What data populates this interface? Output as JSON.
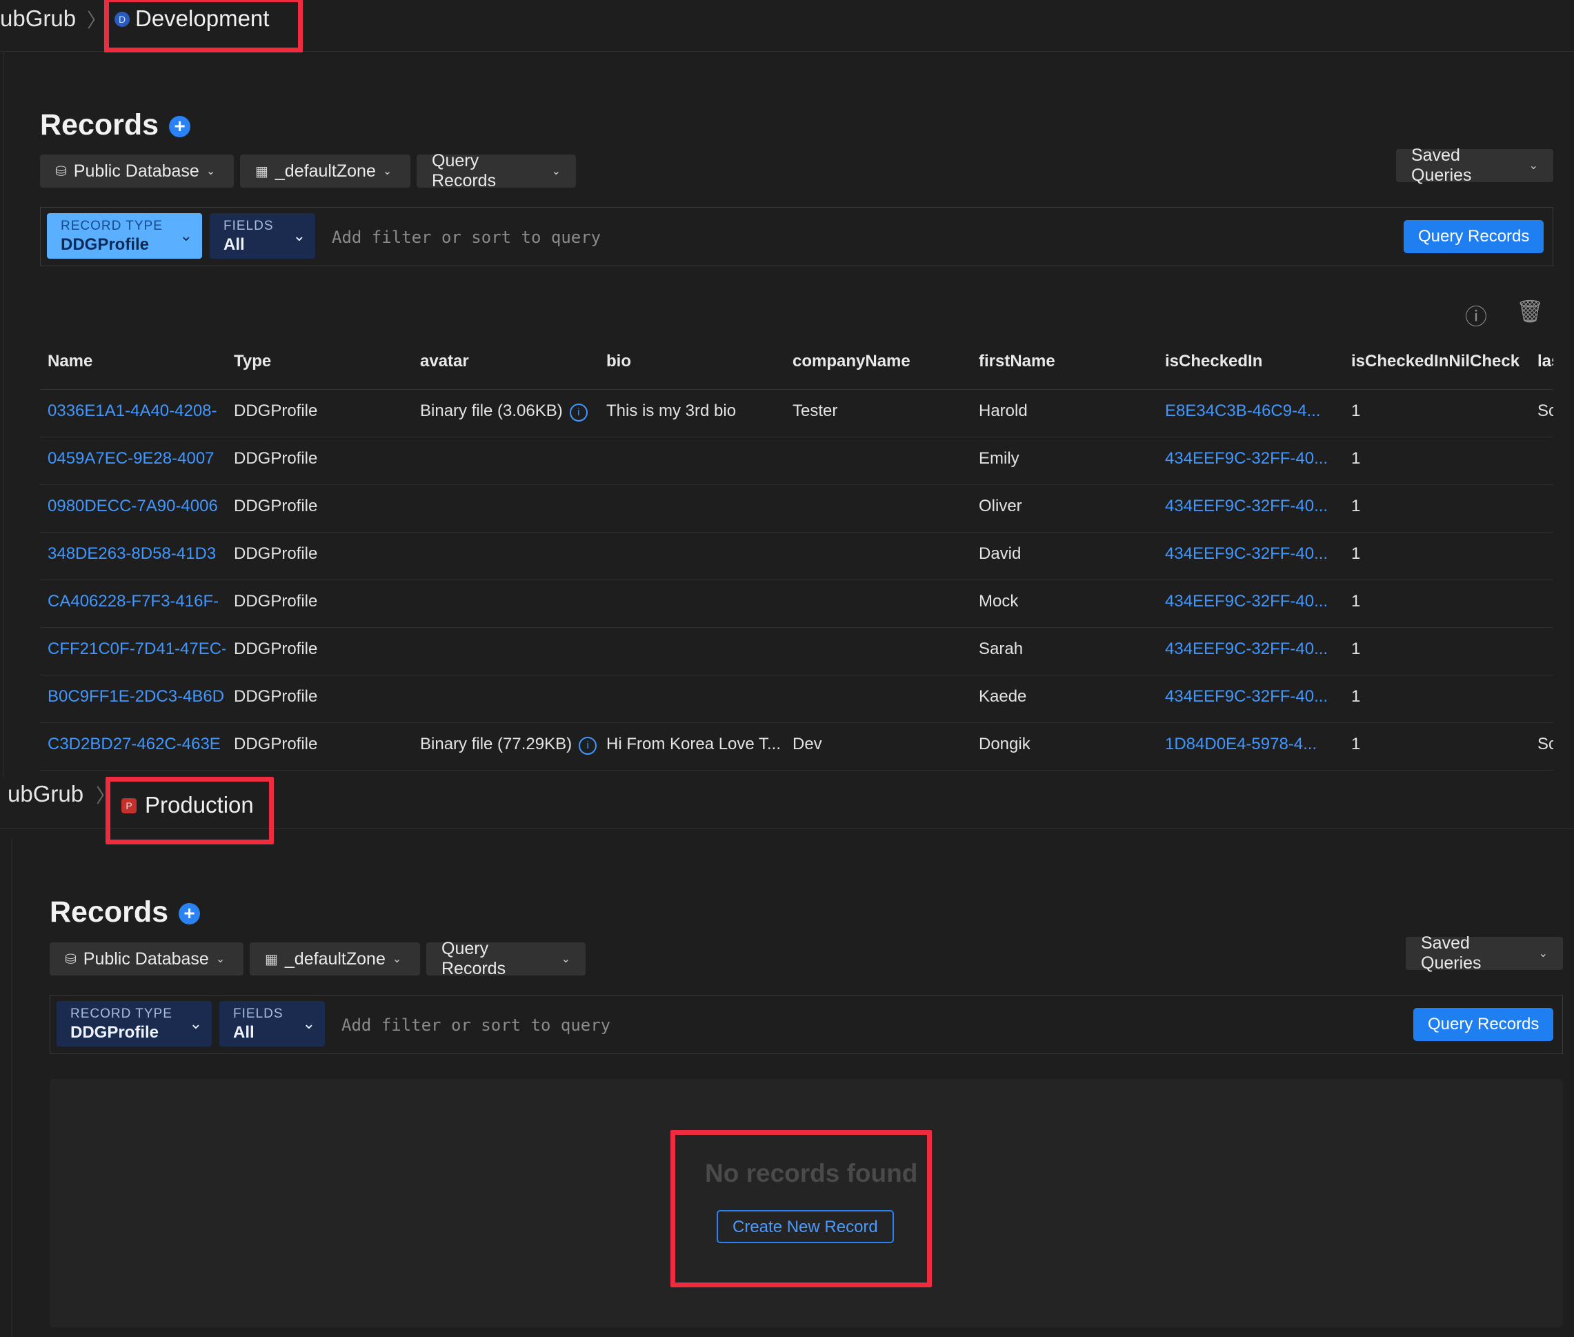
{
  "development": {
    "breadcrumb": {
      "root": "ubGrub",
      "sep": "〉",
      "badge": "D",
      "env": "Development"
    },
    "records_title": "Records",
    "add_symbol": "+",
    "database_pill": "Public Database",
    "zone_pill": "_defaultZone",
    "query_pill": "Query Records",
    "saved_queries": "Saved Queries",
    "record_type": {
      "label": "RECORD TYPE",
      "value": "DDGProfile"
    },
    "fields": {
      "label": "FIELDS",
      "value": "All"
    },
    "filter_placeholder": "Add filter or sort to query",
    "query_button": "Query Records",
    "table": {
      "columns": [
        "Name",
        "Type",
        "avatar",
        "bio",
        "companyName",
        "firstName",
        "isCheckedIn",
        "isCheckedInNilCheck",
        "las"
      ],
      "rows": [
        {
          "name": "0336E1A1-4A40-4208-",
          "type": "DDGProfile",
          "avatar": "Binary file (3.06KB)",
          "avatar_info": "i",
          "bio": "This is my 3rd bio",
          "company": "Tester",
          "first": "Harold",
          "checked": "E8E34C3B-46C9-4...",
          "nil": "1",
          "last": "Sc"
        },
        {
          "name": "0459A7EC-9E28-4007",
          "type": "DDGProfile",
          "avatar": "",
          "avatar_info": "",
          "bio": "",
          "company": "",
          "first": "Emily",
          "checked": "434EEF9C-32FF-40...",
          "nil": "1",
          "last": ""
        },
        {
          "name": "0980DECC-7A90-4006",
          "type": "DDGProfile",
          "avatar": "",
          "avatar_info": "",
          "bio": "",
          "company": "",
          "first": "Oliver",
          "checked": "434EEF9C-32FF-40...",
          "nil": "1",
          "last": ""
        },
        {
          "name": "348DE263-8D58-41D3",
          "type": "DDGProfile",
          "avatar": "",
          "avatar_info": "",
          "bio": "",
          "company": "",
          "first": "David",
          "checked": "434EEF9C-32FF-40...",
          "nil": "1",
          "last": ""
        },
        {
          "name": "CA406228-F7F3-416F-",
          "type": "DDGProfile",
          "avatar": "",
          "avatar_info": "",
          "bio": "",
          "company": "",
          "first": "Mock",
          "checked": "434EEF9C-32FF-40...",
          "nil": "1",
          "last": ""
        },
        {
          "name": "CFF21C0F-7D41-47EC-",
          "type": "DDGProfile",
          "avatar": "",
          "avatar_info": "",
          "bio": "",
          "company": "",
          "first": "Sarah",
          "checked": "434EEF9C-32FF-40...",
          "nil": "1",
          "last": ""
        },
        {
          "name": "B0C9FF1E-2DC3-4B6D",
          "type": "DDGProfile",
          "avatar": "",
          "avatar_info": "",
          "bio": "",
          "company": "",
          "first": "Kaede",
          "checked": "434EEF9C-32FF-40...",
          "nil": "1",
          "last": ""
        },
        {
          "name": "C3D2BD27-462C-463E",
          "type": "DDGProfile",
          "avatar": "Binary file (77.29KB)",
          "avatar_info": "i",
          "bio": "Hi From Korea Love T...",
          "company": "Dev",
          "first": "Dongik",
          "checked": "1D84D0E4-5978-4...",
          "nil": "1",
          "last": "Sc"
        }
      ]
    }
  },
  "production": {
    "breadcrumb": {
      "root": "ubGrub",
      "sep": "〉",
      "badge": "P",
      "env": "Production"
    },
    "records_title": "Records",
    "add_symbol": "+",
    "database_pill": "Public Database",
    "zone_pill": "_defaultZone",
    "query_pill": "Query Records",
    "saved_queries": "Saved Queries",
    "record_type": {
      "label": "RECORD TYPE",
      "value": "DDGProfile"
    },
    "fields": {
      "label": "FIELDS",
      "value": "All"
    },
    "filter_placeholder": "Add filter or sort to query",
    "query_button": "Query Records",
    "empty_state": {
      "title": "No records found",
      "button": "Create New Record"
    }
  },
  "icons": {
    "chevron": "⌄",
    "database": "⛁",
    "zone_grid": "▦",
    "info": "ⓘ",
    "trash": "🗑"
  },
  "colors": {
    "background": "#1e1e1e",
    "accent_blue": "#1f7ff0",
    "link_blue": "#3f97ff",
    "highlight_red": "#ee2b3f"
  }
}
